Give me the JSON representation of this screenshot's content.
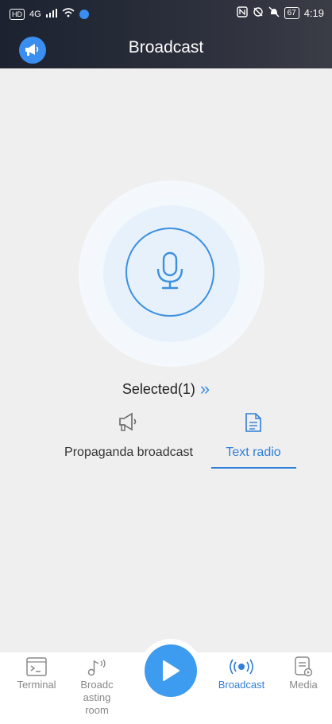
{
  "status_bar": {
    "hd": "HD",
    "signal": "4G",
    "time": "4:19",
    "battery": "67"
  },
  "header": {
    "title": "Broadcast"
  },
  "selection": {
    "label": "Selected(1)",
    "chevron": "»"
  },
  "modes": [
    {
      "label": "Propaganda broadcast",
      "icon": "megaphone-icon",
      "active": false
    },
    {
      "label": "Text radio",
      "icon": "document-icon",
      "active": true
    }
  ],
  "tabs": [
    {
      "label": "Terminal",
      "icon": "terminal-icon"
    },
    {
      "label": "Broadc\nasting\nroom",
      "icon": "music-note-icon"
    },
    {
      "label": "Broadcast",
      "icon": "broadcast-icon"
    },
    {
      "label": "Media",
      "icon": "media-file-icon"
    }
  ],
  "colors": {
    "accent": "#2f7ed8",
    "header_bg": "#252a36",
    "page_bg": "#efefef"
  }
}
